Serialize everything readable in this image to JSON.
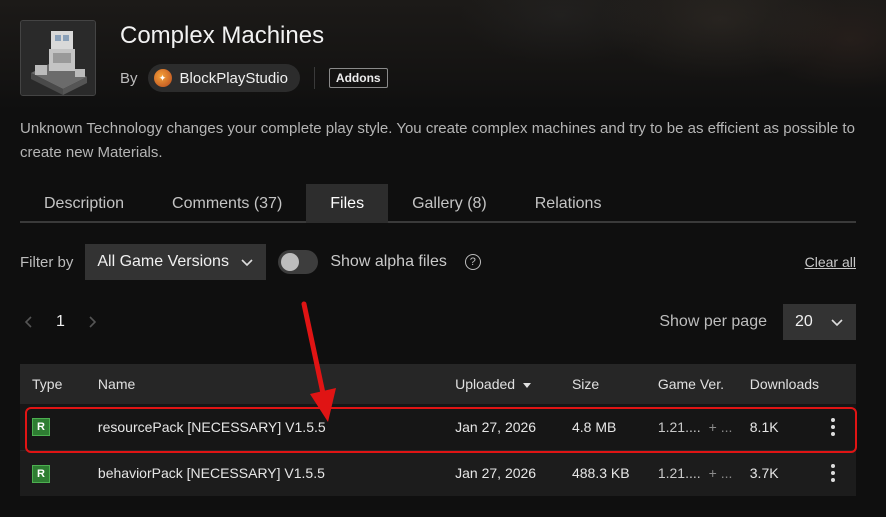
{
  "project": {
    "title": "Complex Machines",
    "by_label": "By",
    "author": "BlockPlayStudio",
    "category_tag": "Addons",
    "description": "Unknown Technology changes your complete play style. You create complex machines and try to be as efficient as possible to create new Materials."
  },
  "tabs": [
    {
      "label": "Description",
      "active": false
    },
    {
      "label": "Comments (37)",
      "active": false
    },
    {
      "label": "Files",
      "active": true
    },
    {
      "label": "Gallery (8)",
      "active": false
    },
    {
      "label": "Relations",
      "active": false
    }
  ],
  "filters": {
    "filter_label": "Filter by",
    "game_version_selected": "All Game Versions",
    "alpha_toggle_label": "Show alpha files",
    "alpha_toggle_on": false,
    "help_glyph": "?",
    "clear_all": "Clear all"
  },
  "pagination": {
    "current_page": "1",
    "per_page_label": "Show per page",
    "per_page_value": "20"
  },
  "table": {
    "columns": [
      "Type",
      "Name",
      "Uploaded",
      "Size",
      "Game Ver.",
      "Downloads"
    ],
    "sorted_by": "Uploaded",
    "rows": [
      {
        "type": "R",
        "name": "resourcePack [NECESSARY] V1.5.5",
        "uploaded": "Jan 27, 2026",
        "size": "4.8 MB",
        "game_version": "1.21....",
        "game_version_more": "+ ...",
        "downloads": "8.1K",
        "highlighted": true
      },
      {
        "type": "R",
        "name": "behaviorPack [NECESSARY] V1.5.5",
        "uploaded": "Jan 27, 2026",
        "size": "488.3 KB",
        "game_version": "1.21....",
        "game_version_more": "+ ...",
        "downloads": "3.7K",
        "highlighted": false
      }
    ]
  },
  "colors": {
    "release_badge": "#2e7d32",
    "highlight_annotation": "#e01414",
    "active_tab_bg": "#2d2d2d",
    "page_bg": "#0f0f0f"
  }
}
